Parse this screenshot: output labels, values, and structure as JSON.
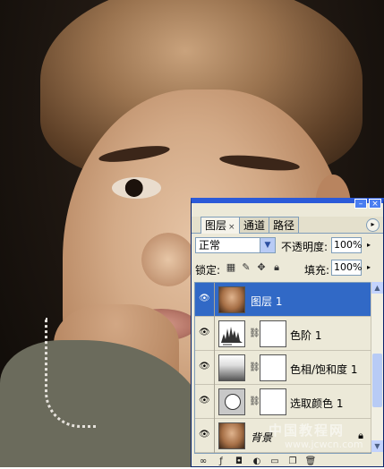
{
  "panel": {
    "tabs": [
      {
        "label": "图层",
        "active": true
      },
      {
        "label": "通道",
        "active": false
      },
      {
        "label": "路径",
        "active": false
      }
    ],
    "tab_close": "×",
    "menu_icon": "panel-menu-icon",
    "blend_mode": "正常",
    "opacity_label": "不透明度:",
    "opacity_value": "100%",
    "lock_label": "锁定:",
    "fill_label": "填充:",
    "fill_value": "100%",
    "layers": [
      {
        "name": "图层 1",
        "type": "pixel",
        "selected": true,
        "visible": true
      },
      {
        "name": "色阶 1",
        "type": "levels-adjustment",
        "selected": false,
        "visible": true
      },
      {
        "name": "色相/饱和度 1",
        "type": "hue-saturation-adjustment",
        "selected": false,
        "visible": true
      },
      {
        "name": "选取颜色 1",
        "type": "selective-color-adjustment",
        "selected": false,
        "visible": true
      },
      {
        "name": "背景",
        "type": "background",
        "selected": false,
        "visible": true,
        "locked": true
      }
    ]
  },
  "watermark": {
    "line1": "中国教程网",
    "line2": "www.jcwcn.com"
  },
  "colors": {
    "selection": "#3169c6",
    "panel_bg": "#ece9d8",
    "titlebar": "#2b5ad8"
  }
}
